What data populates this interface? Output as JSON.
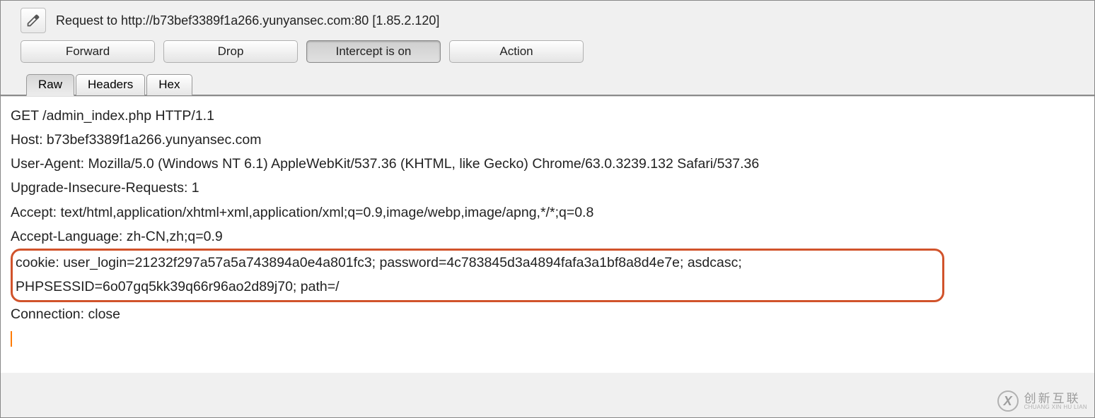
{
  "header": {
    "request_label": "Request to http://b73bef3389f1a266.yunyansec.com:80  [1.85.2.120]"
  },
  "buttons": {
    "forward": "Forward",
    "drop": "Drop",
    "intercept": "Intercept is on",
    "action": "Action"
  },
  "tabs": {
    "raw": "Raw",
    "headers": "Headers",
    "hex": "Hex"
  },
  "request": {
    "line1": "GET /admin_index.php HTTP/1.1",
    "line2": "Host: b73bef3389f1a266.yunyansec.com",
    "line3": "User-Agent: Mozilla/5.0 (Windows NT 6.1) AppleWebKit/537.36 (KHTML, like Gecko) Chrome/63.0.3239.132 Safari/537.36",
    "line4": "Upgrade-Insecure-Requests: 1",
    "line5": "Accept: text/html,application/xhtml+xml,application/xml;q=0.9,image/webp,image/apng,*/*;q=0.8",
    "line6": "Accept-Language: zh-CN,zh;q=0.9",
    "cookie_a": "cookie: user_login=21232f297a57a5a743894a0e4a801fc3; password=4c783845d3a4894fafa3a1bf8a8d4e7e; asdcasc;",
    "cookie_b": "PHPSESSID=6o07gq5kk39q66r96ao2d89j70; path=/",
    "line8": "Connection: close"
  },
  "watermark": {
    "zh": "创新互联",
    "en": "CHUANG XIN HU LIAN"
  }
}
